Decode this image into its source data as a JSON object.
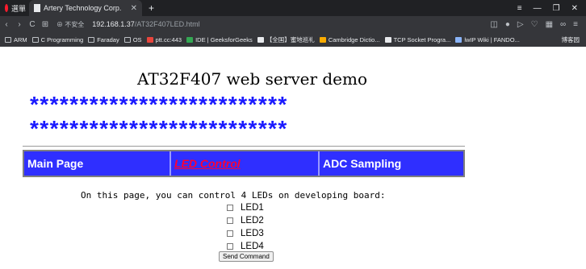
{
  "browser": {
    "app_tab_label": "選單",
    "active_tab_title": "Artery Technology Corp.",
    "new_tab_symbol": "+",
    "url_secure_label": "不安全",
    "url_host": "192.168.1.37",
    "url_path": "/AT32F407LED.html",
    "bookmarks": [
      "ARM",
      "C Programming",
      "Faraday",
      "OS",
      "ptt.cc:443",
      "IDE | GeeksforGeeks",
      "【全国】蜜地巡礼",
      "Cambridge Dictio...",
      "TCP Socket Progra...",
      "lwIP Wiki | FANDO...",
      "博客园"
    ]
  },
  "page": {
    "title": "AT32F407 web server demo",
    "stars_row_1": "**************************",
    "stars_row_2": "**************************",
    "menu": [
      {
        "label": "Main Page"
      },
      {
        "label": "LED Control"
      },
      {
        "label": "ADC Sampling"
      }
    ],
    "description": "On this page, you can control 4 LEDs on developing board:",
    "leds": [
      {
        "label": "LED1",
        "checked": false
      },
      {
        "label": "LED2",
        "checked": false
      },
      {
        "label": "LED3",
        "checked": false
      },
      {
        "label": "LED4",
        "checked": false
      }
    ],
    "send_button": "Send Command"
  },
  "colors": {
    "menu_bg": "#2f2fff",
    "active_menu_text": "#ff0033",
    "stars": "#1a1aff"
  }
}
